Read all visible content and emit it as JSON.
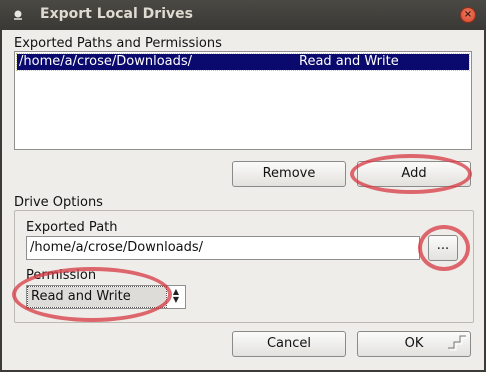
{
  "window": {
    "title": "Export Local Drives",
    "app_icon": "app-icon",
    "close_label": "×"
  },
  "exported_paths": {
    "section_label": "Exported Paths and Permissions",
    "rows": [
      {
        "path": "/home/a/crose/Downloads/",
        "permission": "Read and Write",
        "selected": true
      }
    ]
  },
  "list_buttons": {
    "remove_label": "Remove",
    "add_label": "Add"
  },
  "drive_options": {
    "section_label": "Drive Options",
    "exported_path_label": "Exported Path",
    "exported_path_value": "/home/a/crose/Downloads/",
    "browse_label": "...",
    "permission_label": "Permission",
    "permission_value": "Read and Write"
  },
  "dialog_buttons": {
    "cancel_label": "Cancel",
    "ok_label": "OK"
  },
  "colors": {
    "annotation": "#d63842",
    "selection": "#0a0a6e",
    "titlebar": "#3c3b37"
  }
}
